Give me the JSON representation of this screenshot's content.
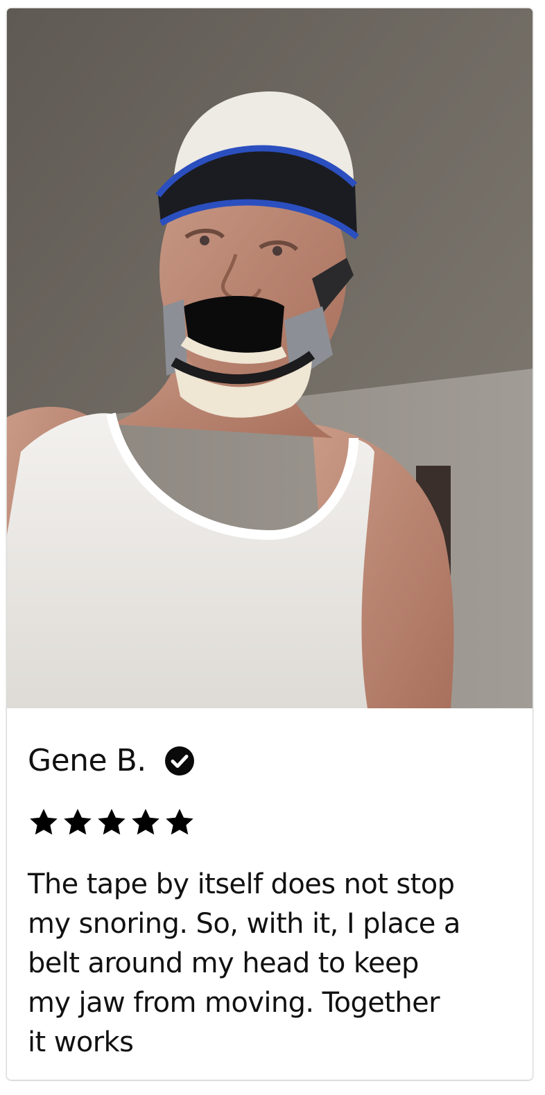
{
  "review_card": {
    "reviewer_name": "Gene B.",
    "verified_icon": "check-circle-icon",
    "rating": 5,
    "rating_max": 5,
    "star_icon": "star-icon",
    "review_text": "The tape by itself does not stop\nmy snoring. So, with it, I place a\nbelt around my head to keep\nmy jaw  from moving. Together\nit works",
    "colors": {
      "text": "#111111",
      "star": "#000000",
      "background": "#ffffff"
    }
  }
}
